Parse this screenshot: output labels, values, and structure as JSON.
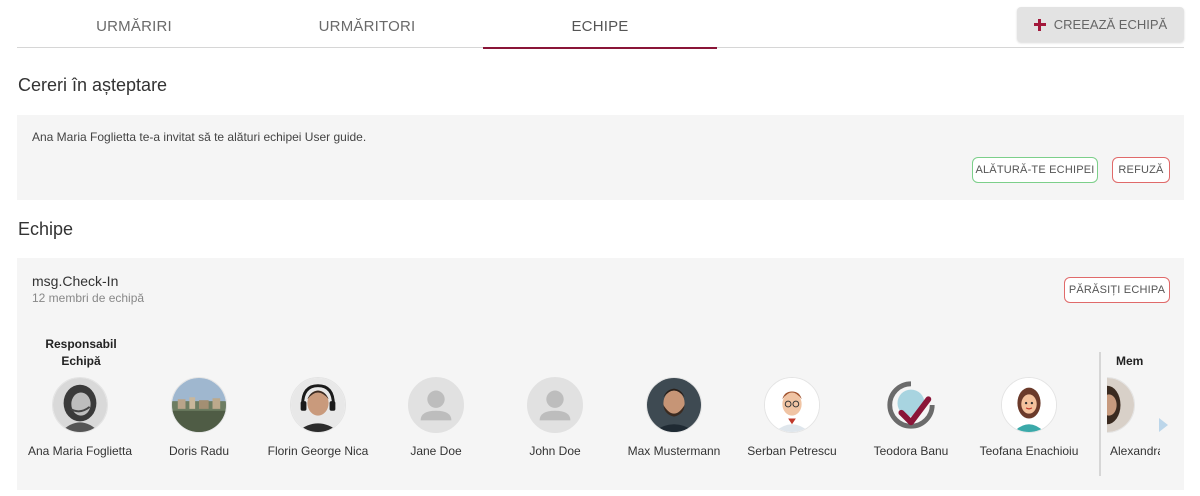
{
  "tabs": [
    {
      "label": "URMĂRIRI"
    },
    {
      "label": "URMĂRITORI"
    },
    {
      "label": "ECHIPE"
    }
  ],
  "create_team_label": "CREEAZĂ ECHIPĂ",
  "pending": {
    "title": "Cereri în așteptare",
    "message": "Ana Maria Foglietta te-a invitat să te alături echipei User guide.",
    "join_label": "ALĂTURĂ-TE ECHIPEI",
    "refuse_label": "REFUZĂ"
  },
  "teams": {
    "title": "Echipe",
    "team": {
      "name": "msg.Check-In",
      "count": "12 membri de echipă",
      "leave_label": "PĂRĂSIȚI ECHIPA",
      "responsible_label": "Responsabil Echipă",
      "members_label": "Membri",
      "members": [
        {
          "name": "Ana Maria Foglietta",
          "avatar": "photo-woman"
        },
        {
          "name": "Doris Radu",
          "avatar": "photo-city"
        },
        {
          "name": "Florin George Nica",
          "avatar": "photo-headset-man"
        },
        {
          "name": "Jane Doe",
          "avatar": "default-user"
        },
        {
          "name": "John Doe",
          "avatar": "default-user"
        },
        {
          "name": "Max Mustermann",
          "avatar": "photo-bearded-man"
        },
        {
          "name": "Serban Petrescu",
          "avatar": "cartoon-man"
        },
        {
          "name": "Teodora Banu",
          "avatar": "checkmark-logo"
        },
        {
          "name": "Teofana Enachioiu",
          "avatar": "cartoon-woman"
        }
      ],
      "partial_member": {
        "name": "Alexandra",
        "avatar": "photo-woman-dark"
      }
    }
  },
  "colors": {
    "accent": "#8a1538",
    "join_border": "#7ccf8a",
    "refuse_border": "#e06a6a",
    "panel_bg": "#f5f5f5"
  }
}
